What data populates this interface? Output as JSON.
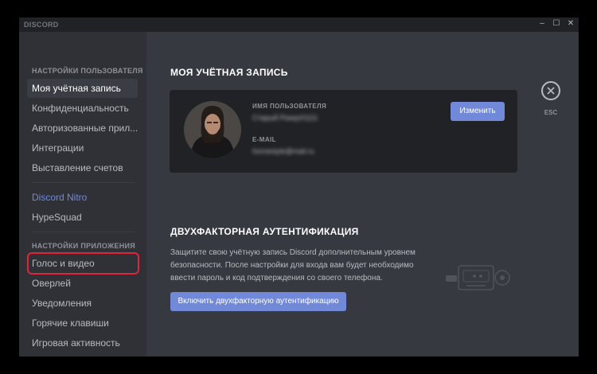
{
  "app": {
    "brand": "DISCORD"
  },
  "window_controls": {
    "minimize": "–",
    "maximize": "☐",
    "close": "✕"
  },
  "sidebar": {
    "user_settings_header": "Настройки пользователя",
    "user_items": [
      {
        "label": "Моя учётная запись"
      },
      {
        "label": "Конфиденциальность"
      },
      {
        "label": "Авторизованные прил..."
      },
      {
        "label": "Интеграции"
      },
      {
        "label": "Выставление счетов"
      }
    ],
    "nitro": "Discord Nitro",
    "hypesquad": "HypeSquad",
    "app_settings_header": "Настройки приложения",
    "app_items": [
      {
        "label": "Голос и видео"
      },
      {
        "label": "Оверлей"
      },
      {
        "label": "Уведомления"
      },
      {
        "label": "Горячие клавиши"
      },
      {
        "label": "Игровая активность"
      }
    ]
  },
  "account": {
    "title": "Моя учётная запись",
    "username_label": "Имя пользователя",
    "username_value": "Старый Рокер#1111",
    "email_label": "E-mail",
    "email_value": "hornestyle@mail.ru",
    "edit_button": "Изменить"
  },
  "two_factor": {
    "title": "Двухфакторная аутентификация",
    "description": "Защитите свою учётную запись Discord дополнительным уровнем безопасности. После настройки для входа вам будет необходимо ввести пароль и код подтверждения со своего телефона.",
    "enable_button": "Включить двухфакторную аутентификацию"
  },
  "close": {
    "label": "ESC"
  },
  "colors": {
    "accent": "#7289da",
    "highlight": "#e1243a",
    "background": "#36393f",
    "sidebar": "#2f3136"
  }
}
